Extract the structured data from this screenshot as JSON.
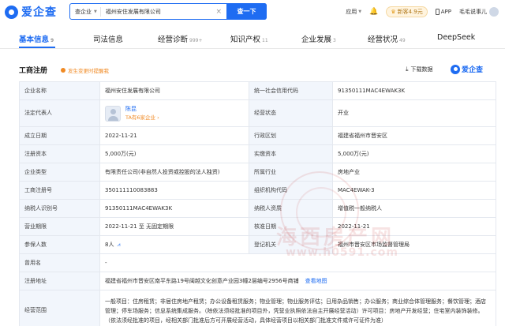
{
  "header": {
    "logo_text": "爱企查",
    "search_scope": "查企业",
    "search_value": "福州安住发展有限公司",
    "search_button": "查一下",
    "menu_apps": "应用",
    "vip_badge": "新客4.9元",
    "app_link": "APP",
    "username": "毛毛说事儿"
  },
  "nav": {
    "tabs": [
      {
        "label": "基本信息",
        "count": "9"
      },
      {
        "label": "司法信息",
        "count": ""
      },
      {
        "label": "经营诊断",
        "count": "999+"
      },
      {
        "label": "知识产权",
        "count": "11"
      },
      {
        "label": "企业发展",
        "count": "3"
      },
      {
        "label": "经营状况",
        "count": "49"
      },
      {
        "label": "DeepSeek",
        "count": ""
      }
    ]
  },
  "section": {
    "title": "工商注册",
    "history_link": "发生变更时提醒我",
    "download": "下载数据",
    "brand": "爱企查"
  },
  "table": {
    "rows": [
      {
        "l1": "企业名称",
        "v1": "福州安住发展有限公司",
        "l2": "统一社会信用代码",
        "v2": "91350111MAC4EWAK3K"
      },
      {
        "l1": "法定代表人",
        "rep_name": "陈昆",
        "rep_sub": "TA有6家企业",
        "l2": "经营状态",
        "v2": "开业"
      },
      {
        "l1": "成立日期",
        "v1": "2022-11-21",
        "l2": "行政区划",
        "v2": "福建省福州市晋安区"
      },
      {
        "l1": "注册资本",
        "v1": "5,000万(元)",
        "l2": "实缴资本",
        "v2": "5,000万(元)"
      },
      {
        "l1": "企业类型",
        "v1": "有限责任公司(非自然人投资或控股的法人独资)",
        "l2": "所属行业",
        "v2": "房地产业"
      },
      {
        "l1": "工商注册号",
        "v1": "350111110083883",
        "l2": "组织机构代码",
        "v2": "MAC4EWAK-3"
      },
      {
        "l1": "纳税人识别号",
        "v1": "91350111MAC4EWAK3K",
        "l2": "纳税人资质",
        "v2": "增值税一般纳税人"
      },
      {
        "l1": "营业期限",
        "v1": "2022-11-21 至 无固定期限",
        "l2": "核准日期",
        "v2": "2022-11-21"
      },
      {
        "l1": "参保人数",
        "v1": "8人",
        "l2": "登记机关",
        "v2": "福州市晋安区市场监督管理局"
      },
      {
        "l1": "曾用名",
        "v1": "-"
      },
      {
        "l1": "注册地址",
        "v1": "福建省福州市晋安区南平东路19号闽越文化创意产业园3幢2层编号2956号商铺",
        "map_link": "查看地图"
      },
      {
        "l1": "经营范围",
        "v1": "一般项目：住房租赁；非居住房地产租赁；办公设备租赁服务；物业管理；物业服务评估；日用杂品销售；办公服务；商业综合体管理服务；餐饮管理；酒店管理；停车场服务；信息系统集成服务。（除依法须经批准的项目外，凭营业执照依法自主开展经营活动）许可项目：房地产开发经营；住宅室内装饰装修。（依法须经批准的项目，经相关部门批准后方可开展经营活动，具体经营项目以相关部门批准文件或许可证件为准）"
      }
    ]
  },
  "watermark": {
    "text": "海西房产网",
    "url": "www.h0591.com"
  },
  "colors": {
    "accent": "#1e6cf2",
    "warning": "#f08a24",
    "label_bg": "#f2f6fc",
    "border": "#e4e8ef"
  }
}
